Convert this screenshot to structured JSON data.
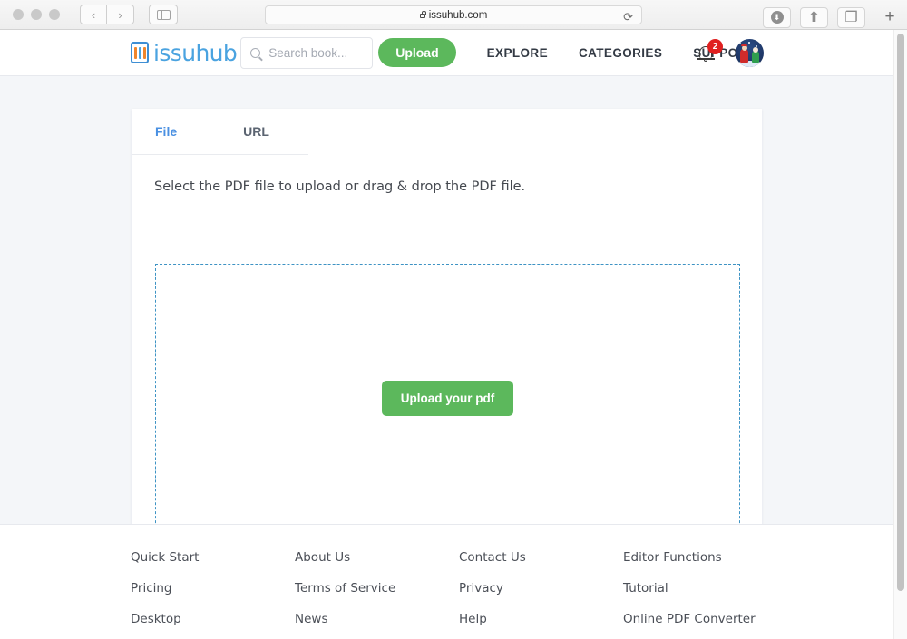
{
  "browser": {
    "url": "issuhub.com",
    "back_label": "‹",
    "forward_label": "›",
    "reload_label": "⟳",
    "download_label": "⬇",
    "share_label": "⬆",
    "tabs_label": "❐",
    "new_tab_label": "+"
  },
  "header": {
    "logo_text": "issuhub",
    "search": {
      "placeholder": "Search book...",
      "value": ""
    },
    "upload_label": "Upload",
    "nav": [
      {
        "label": "EXPLORE"
      },
      {
        "label": "CATEGORIES"
      },
      {
        "label": "SUPPORT"
      }
    ],
    "notification_count": "2"
  },
  "card": {
    "tabs": [
      {
        "label": "File",
        "active": true
      },
      {
        "label": "URL",
        "active": false
      }
    ],
    "hint": "Select the PDF file to upload or drag & drop the PDF file.",
    "dropzone_button": "Upload your pdf"
  },
  "footer": {
    "columns": [
      {
        "links": [
          "Quick Start",
          "Pricing",
          "Desktop"
        ]
      },
      {
        "links": [
          "About Us",
          "Terms of Service",
          "News"
        ]
      },
      {
        "links": [
          "Contact Us",
          "Privacy",
          "Help"
        ]
      },
      {
        "links": [
          "Editor Functions",
          "Tutorial",
          "Online PDF Converter"
        ]
      }
    ]
  },
  "colors": {
    "brand_blue": "#4aa3e0",
    "accent_green": "#5cb85c",
    "badge_red": "#e02020",
    "dropzone_blue": "#3e93c4",
    "page_bg": "#f4f6f9"
  }
}
